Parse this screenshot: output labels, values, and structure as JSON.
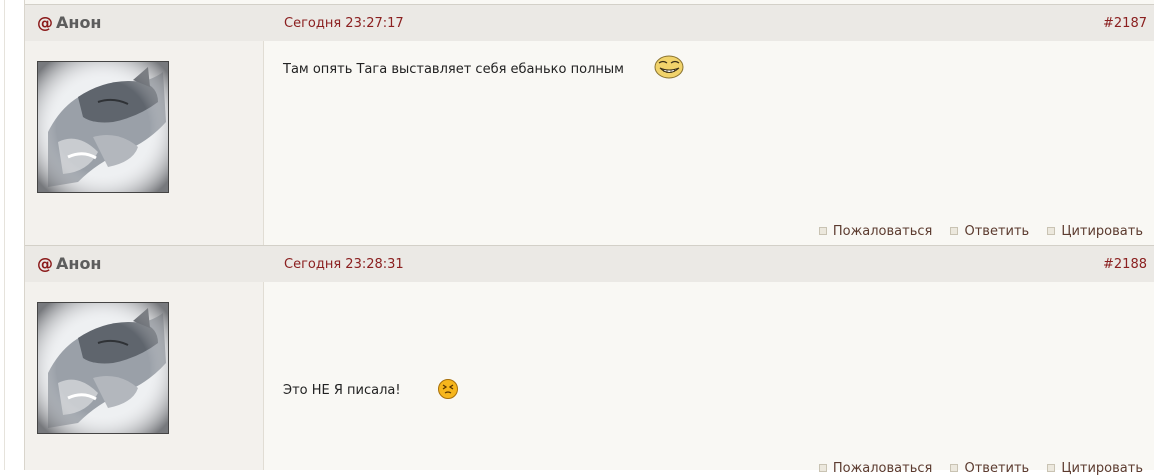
{
  "posts": [
    {
      "author_prefix": "@",
      "author": "Анон",
      "date": "Сегодня 23:27:17",
      "number": "#2187",
      "message": "Там опять Тага выставляет себя ебанько полным",
      "smiley": "troll-face-icon",
      "actions": [
        "Пожаловаться",
        "Ответить",
        "Цитировать"
      ]
    },
    {
      "author_prefix": "@",
      "author": "Анон",
      "date": "Сегодня 23:28:31",
      "number": "#2188",
      "message": "Это НЕ Я писала!",
      "smiley": "angry-smiley-icon",
      "actions": [
        "Пожаловаться",
        "Ответить",
        "Цитировать"
      ]
    }
  ],
  "colors": {
    "header_bg": "#ebe9e5",
    "content_bg": "#f9f8f4",
    "sidebar_bg": "#f3f1ed",
    "accent": "#8b2020"
  }
}
